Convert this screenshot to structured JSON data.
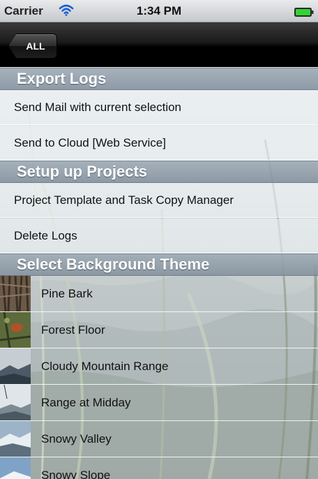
{
  "status": {
    "carrier": "Carrier",
    "time": "1:34 PM",
    "battery_color": "#2bd12b"
  },
  "nav": {
    "back_label": "ALL"
  },
  "sections": {
    "export": {
      "header": "Export Logs",
      "items": [
        "Send Mail with current selection",
        "Send to Cloud [Web Service]"
      ]
    },
    "setup": {
      "header": "Setup up Projects",
      "items": [
        "Project Template and Task Copy Manager",
        "Delete Logs"
      ]
    },
    "themes": {
      "header": "Select Background Theme",
      "items": [
        {
          "label": "Pine Bark",
          "icon": "pine-bark-thumbnail"
        },
        {
          "label": "Forest Floor",
          "icon": "forest-floor-thumbnail"
        },
        {
          "label": "Cloudy Mountain Range",
          "icon": "cloudy-mountain-thumbnail"
        },
        {
          "label": "Range at Midday",
          "icon": "range-midday-thumbnail"
        },
        {
          "label": "Snowy Valley",
          "icon": "snowy-valley-thumbnail"
        },
        {
          "label": "Snowy Slope",
          "icon": "snowy-slope-thumbnail"
        }
      ]
    }
  }
}
